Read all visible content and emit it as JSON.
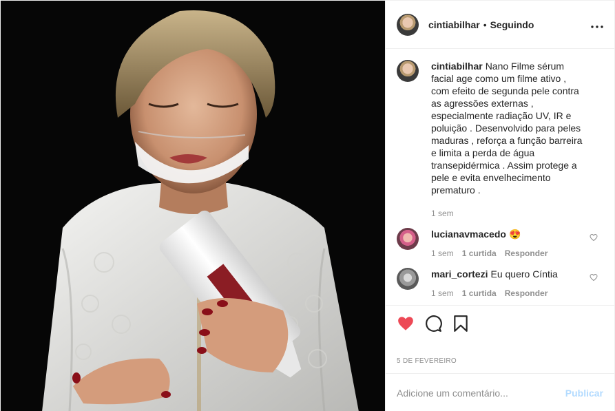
{
  "post": {
    "author": "cintiabilhar",
    "separator": "•",
    "follow_status": "Seguindo",
    "more": "•••",
    "caption": "Nano Filme sérum facial age como um filme ativo , com efeito de segunda pele contra as agressões externas , especialmente radiação UV, IR e poluição . Desenvolvido para peles maduras , reforça a função barreira e limita a perda de água transepidérmica . Assim protege a pele e evita envelhecimento prematuro .",
    "caption_time": "1 sem",
    "date": "5 DE FEVEREIRO"
  },
  "comments": [
    {
      "user": "lucianavmacedo",
      "text": "😍",
      "time": "1 sem",
      "likes": "1 curtida",
      "reply": "Responder"
    },
    {
      "user": "mari_cortezi",
      "text": "Eu quero Cíntia",
      "time": "1 sem",
      "likes": "1 curtida",
      "reply": "Responder"
    }
  ],
  "add_comment": {
    "placeholder": "Adicione um comentário...",
    "publish": "Publicar"
  },
  "colors": {
    "like_red": "#ed4956",
    "publish_disabled": "#b3dbff",
    "muted": "#8e8e8e"
  },
  "icons": [
    "heart-icon",
    "comment-icon",
    "bookmark-icon",
    "more-icon"
  ]
}
